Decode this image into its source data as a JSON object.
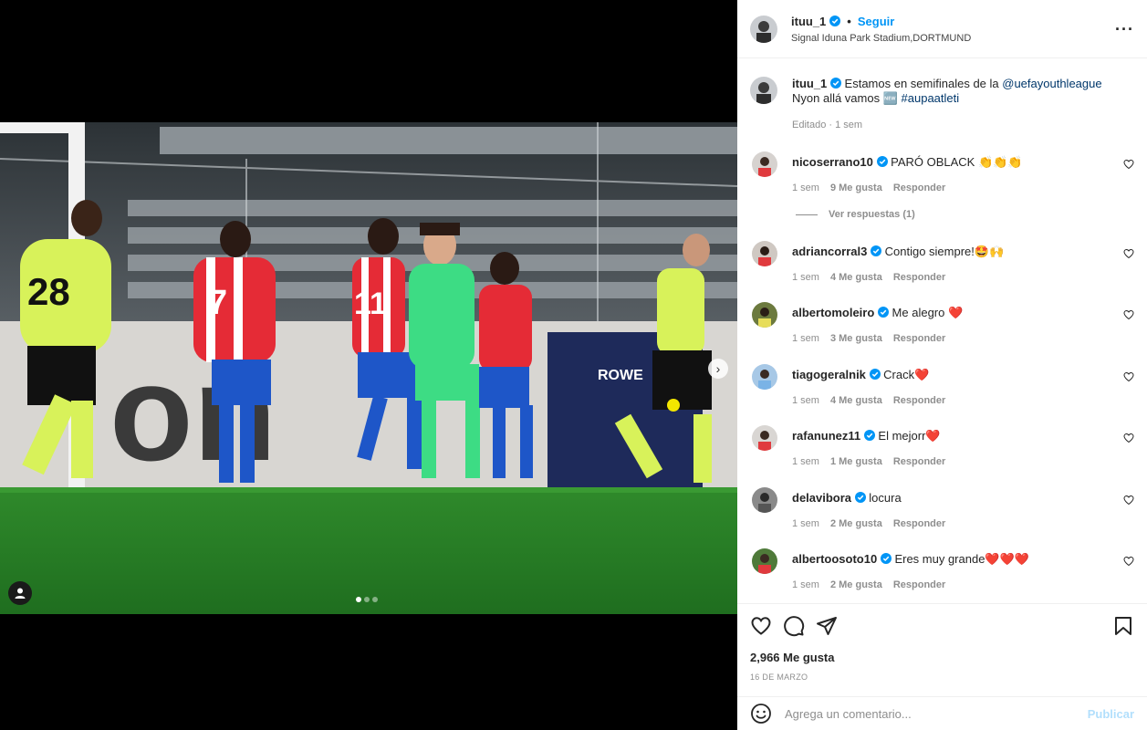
{
  "media": {
    "image_description_icon": "user-tag-icon",
    "next_icon": "chevron-right-icon",
    "slides_total": 3,
    "slide_active": 1,
    "jerseys": [
      "28",
      "7",
      "11"
    ]
  },
  "post": {
    "username": "ituu_1",
    "follow_label": "Seguir",
    "location": "Signal Iduna Park Stadium,DORTMUND",
    "caption_prefix": "Estamos en semifinales de la ",
    "caption_mention": "@uefayouthleague",
    "caption_line2": "Nyon allá vamos ",
    "caption_emoji": "🆕",
    "caption_hashtag": "#aupaatleti",
    "edited": "Editado · 1 sem"
  },
  "comments": [
    {
      "user": "nicoserrano10",
      "text": "PARÓ OBLACK 👏👏👏",
      "time": "1 sem",
      "likes": "9 Me gusta",
      "reply": "Responder"
    },
    {
      "user": "adriancorral3",
      "text": "Contigo siempre!🤩🙌",
      "time": "1 sem",
      "likes": "4 Me gusta",
      "reply": "Responder"
    },
    {
      "user": "albertomoleiro",
      "text": "Me alegro ❤️",
      "time": "1 sem",
      "likes": "3 Me gusta",
      "reply": "Responder"
    },
    {
      "user": "tiagogeralnik",
      "text": "Crack❤️",
      "time": "1 sem",
      "likes": "4 Me gusta",
      "reply": "Responder"
    },
    {
      "user": "rafanunez11",
      "text": "El mejorr❤️",
      "time": "1 sem",
      "likes": "1 Me gusta",
      "reply": "Responder"
    },
    {
      "user": "delavibora",
      "text": "locura",
      "time": "1 sem",
      "likes": "2 Me gusta",
      "reply": "Responder"
    },
    {
      "user": "albertoosoto10",
      "text": "Eres muy grande❤️❤️❤️",
      "time": "1 sem",
      "likes": "2 Me gusta",
      "reply": "Responder"
    }
  ],
  "view_replies": "Ver respuestas (1)",
  "actions": {
    "likes": "2,966 Me gusta",
    "date": "16 DE MARZO"
  },
  "composer": {
    "placeholder": "Agrega un comentario...",
    "post_label": "Publicar"
  },
  "colors": {
    "link": "#00376b",
    "follow": "#0095f6",
    "verified": "#0095f6",
    "muted": "#8e8e8e"
  }
}
